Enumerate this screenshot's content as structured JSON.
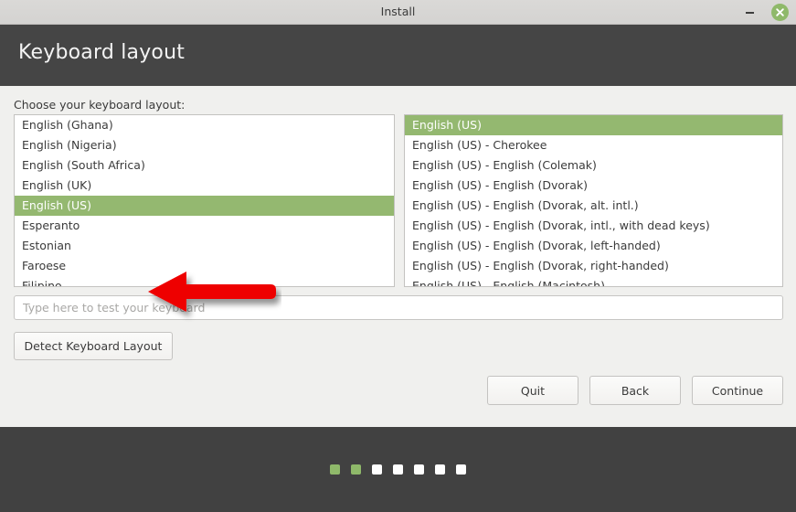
{
  "window": {
    "title": "Install",
    "minimize_icon": "minimize-icon",
    "close_icon": "close-icon",
    "close_button_color": "#8fb96a"
  },
  "header": {
    "title": "Keyboard layout",
    "background": "#454545"
  },
  "main": {
    "prompt": "Choose your keyboard layout:",
    "accent_color": "#94b870",
    "layout_list": {
      "selected": "English (US)",
      "items": [
        "English (Ghana)",
        "English (Nigeria)",
        "English (South Africa)",
        "English (UK)",
        "English (US)",
        "Esperanto",
        "Estonian",
        "Faroese",
        "Filipino"
      ]
    },
    "variant_list": {
      "selected": "English (US)",
      "items": [
        "English (US)",
        "English (US) - Cherokee",
        "English (US) - English (Colemak)",
        "English (US) - English (Dvorak)",
        "English (US) - English (Dvorak, alt. intl.)",
        "English (US) - English (Dvorak, intl., with dead keys)",
        "English (US) - English (Dvorak, left-handed)",
        "English (US) - English (Dvorak, right-handed)",
        "English (US) - English (Macintosh)"
      ]
    },
    "test_field": {
      "value": "",
      "placeholder": "Type here to test your keyboard"
    },
    "detect_button": "Detect Keyboard Layout"
  },
  "nav": {
    "quit": "Quit",
    "back": "Back",
    "continue": "Continue"
  },
  "footer": {
    "total_steps": 7,
    "completed_steps": 2,
    "done_color": "#8fb96a",
    "pending_color": "#ffffff"
  },
  "annotation": {
    "arrow_icon": "red-left-arrow-icon",
    "arrow_color": "#ee0000",
    "points_at": "English (US)"
  }
}
